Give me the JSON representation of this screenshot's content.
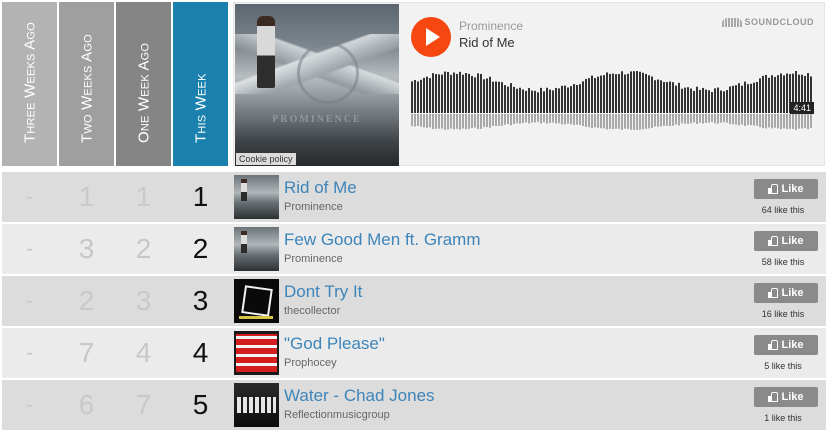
{
  "headers": {
    "three_weeks_ago": "Three Weeks Ago",
    "two_weeks_ago": "Two Weeks Ago",
    "one_week_ago": "One Week Ago",
    "this_week": "This Week"
  },
  "player": {
    "artist": "Prominence",
    "track": "Rid of Me",
    "brand": "SOUNDCLOUD",
    "duration": "4:41",
    "artwork_title": "PROMINENCE",
    "cookie_policy": "Cookie policy",
    "play_icon": "play-icon",
    "colors": {
      "play": "#f5470f",
      "brand": "#999999"
    }
  },
  "like_label": "Like",
  "rows": [
    {
      "three": "-",
      "two": "1",
      "one": "1",
      "now": "1",
      "song": "Rid of Me",
      "artist": "Prominence",
      "likes": "64 like this"
    },
    {
      "three": "-",
      "two": "3",
      "one": "2",
      "now": "2",
      "song": "Few Good Men ft. Gramm",
      "artist": "Prominence",
      "likes": "58 like this"
    },
    {
      "three": "-",
      "two": "2",
      "one": "3",
      "now": "3",
      "song": "Dont Try It",
      "artist": "thecollector",
      "likes": "16 like this"
    },
    {
      "three": "-",
      "two": "7",
      "one": "4",
      "now": "4",
      "song": "\"God Please\"",
      "artist": "Prophocey",
      "likes": "5 like this"
    },
    {
      "three": "-",
      "two": "6",
      "one": "7",
      "now": "5",
      "song": "Water - Chad Jones",
      "artist": "Reflectionmusicgroup",
      "likes": "1 like this"
    }
  ],
  "colors": {
    "this_week": "#1a80ad",
    "link": "#3d85b9",
    "like_button": "#8a8a8a"
  }
}
